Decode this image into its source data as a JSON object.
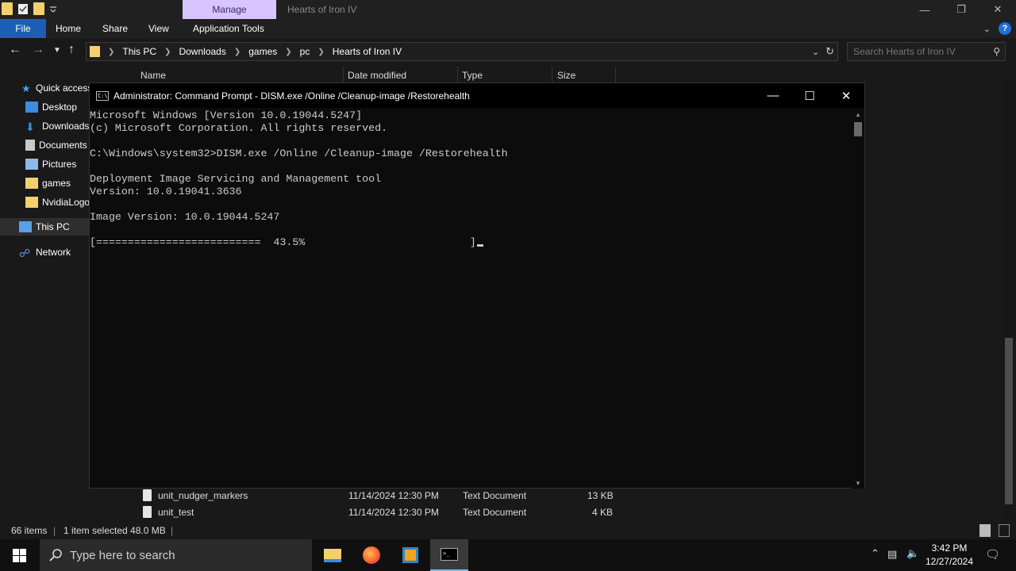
{
  "explorer": {
    "manage_tab": "Manage",
    "title": "Hearts of Iron IV",
    "ribbon_tabs": [
      "File",
      "Home",
      "Share",
      "View",
      "Application Tools"
    ],
    "breadcrumb": [
      "This PC",
      "Downloads",
      "games",
      "pc",
      "Hearts of Iron IV"
    ],
    "search_placeholder": "Search Hearts of Iron IV",
    "columns": [
      "Name",
      "Date modified",
      "Type",
      "Size"
    ],
    "nav_items": [
      "Quick access",
      "Desktop",
      "Downloads",
      "Documents",
      "Pictures",
      "games",
      "NvidiaLogo",
      "This PC",
      "Network"
    ],
    "files": [
      {
        "name": "unit_nudger_markers",
        "date": "11/14/2024 12:30 PM",
        "type": "Text Document",
        "size": "13 KB"
      },
      {
        "name": "unit_test",
        "date": "11/14/2024 12:30 PM",
        "type": "Text Document",
        "size": "4 KB"
      }
    ],
    "status": {
      "items": "66 items",
      "selected": "1 item selected  48.0 MB"
    }
  },
  "cmd": {
    "title": "Administrator: Command Prompt - DISM.exe  /Online /Cleanup-image /Restorehealth",
    "lines": [
      "Microsoft Windows [Version 10.0.19044.5247]",
      "(c) Microsoft Corporation. All rights reserved.",
      "",
      "C:\\Windows\\system32>DISM.exe /Online /Cleanup-image /Restorehealth",
      "",
      "Deployment Image Servicing and Management tool",
      "Version: 10.0.19041.3636",
      "",
      "Image Version: 10.0.19044.5247",
      "",
      "[==========================  43.5%                          ]"
    ],
    "progress_percent": 43.5
  },
  "taskbar": {
    "search_placeholder": "Type here to search",
    "time": "3:42 PM",
    "date": "12/27/2024"
  },
  "colors": {
    "accent": "#1a5fb4",
    "manage_tab": "#d8c5ff",
    "console_text": "#cccccc"
  }
}
